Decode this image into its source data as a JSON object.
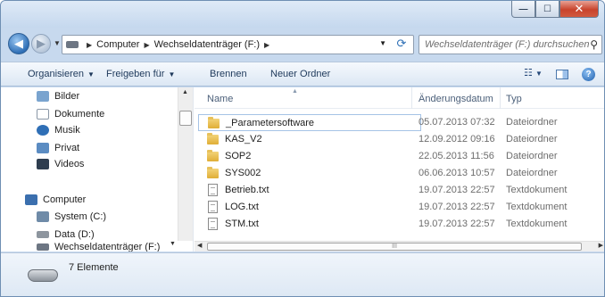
{
  "window": {
    "buttons": {
      "minimize": "—",
      "maximize": "☐",
      "close": "✕"
    }
  },
  "address": {
    "crumbs": [
      "Computer",
      "Wechseldatenträger (F:)"
    ],
    "search_placeholder": "Wechseldatenträger (F:) durchsuchen"
  },
  "toolbar": {
    "organize": "Organisieren",
    "share": "Freigeben für",
    "burn": "Brennen",
    "new_folder": "Neuer Ordner"
  },
  "nav": {
    "items": [
      {
        "label": "Bilder",
        "icon": "pictures-icon",
        "color": "#7aa4cf"
      },
      {
        "label": "Dokumente",
        "icon": "documents-icon",
        "color": "#cfd8e2"
      },
      {
        "label": "Musik",
        "icon": "music-icon",
        "color": "#2f6fb6"
      },
      {
        "label": "Privat",
        "icon": "library-icon",
        "color": "#5b8cc2"
      },
      {
        "label": "Videos",
        "icon": "videos-icon",
        "color": "#2e3d4f"
      },
      {
        "label": "Computer",
        "icon": "computer-icon",
        "color": "#3b6fae"
      },
      {
        "label": "System (C:)",
        "icon": "drive-c-icon",
        "color": "#6f8ba8"
      },
      {
        "label": "Data (D:)",
        "icon": "drive-d-icon",
        "color": "#8d959e"
      },
      {
        "label": "Wechseldatenträger (F:)",
        "icon": "removable-drive-icon",
        "color": "#6d7683"
      }
    ]
  },
  "files": {
    "columns": {
      "name": "Name",
      "date": "Änderungsdatum",
      "type": "Typ"
    },
    "rows": [
      {
        "name": "_Parametersoftware",
        "date": "05.07.2013 07:32",
        "type": "Dateiordner",
        "kind": "folder"
      },
      {
        "name": "KAS_V2",
        "date": "12.09.2012 09:16",
        "type": "Dateiordner",
        "kind": "folder"
      },
      {
        "name": "SOP2",
        "date": "22.05.2013 11:56",
        "type": "Dateiordner",
        "kind": "folder"
      },
      {
        "name": "SYS002",
        "date": "06.06.2013 10:57",
        "type": "Dateiordner",
        "kind": "folder"
      },
      {
        "name": "Betrieb.txt",
        "date": "19.07.2013 22:57",
        "type": "Textdokument",
        "kind": "text"
      },
      {
        "name": "LOG.txt",
        "date": "19.07.2013 22:57",
        "type": "Textdokument",
        "kind": "text"
      },
      {
        "name": "STM.txt",
        "date": "19.07.2013 22:57",
        "type": "Textdokument",
        "kind": "text"
      }
    ]
  },
  "details": {
    "count_text": "7 Elemente"
  },
  "scroll": {
    "grip": "III"
  }
}
